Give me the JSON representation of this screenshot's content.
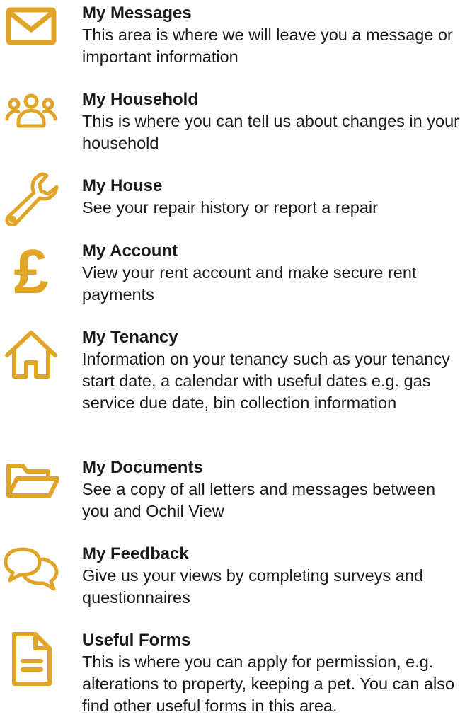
{
  "accent_color": "#E0A526",
  "items": [
    {
      "icon": "envelope-icon",
      "title": "My Messages",
      "description": "This area is where we will leave you a message or important information"
    },
    {
      "icon": "people-icon",
      "title": "My Household",
      "description": "This is where you can tell us about changes in your household"
    },
    {
      "icon": "wrench-icon",
      "title": "My House",
      "description": "See your repair history or report a repair"
    },
    {
      "icon": "pound-icon",
      "title": "My Account",
      "description": "View your rent account and make secure rent payments"
    },
    {
      "icon": "house-icon",
      "title": "My Tenancy",
      "description": "Information on your tenancy such as your tenancy start date, a calendar with useful dates e.g. gas service due date, bin collection information"
    },
    {
      "icon": "folder-icon",
      "title": "My Documents",
      "description": "See a copy of all letters and messages between you and Ochil View"
    },
    {
      "icon": "chat-bubbles-icon",
      "title": "My Feedback",
      "description": "Give us your views by completing surveys and questionnaires"
    },
    {
      "icon": "document-icon",
      "title": "Useful Forms",
      "description": "This is where you can apply for permission, e.g. alterations to property, keeping a pet. You can also find other useful forms in this area."
    }
  ]
}
